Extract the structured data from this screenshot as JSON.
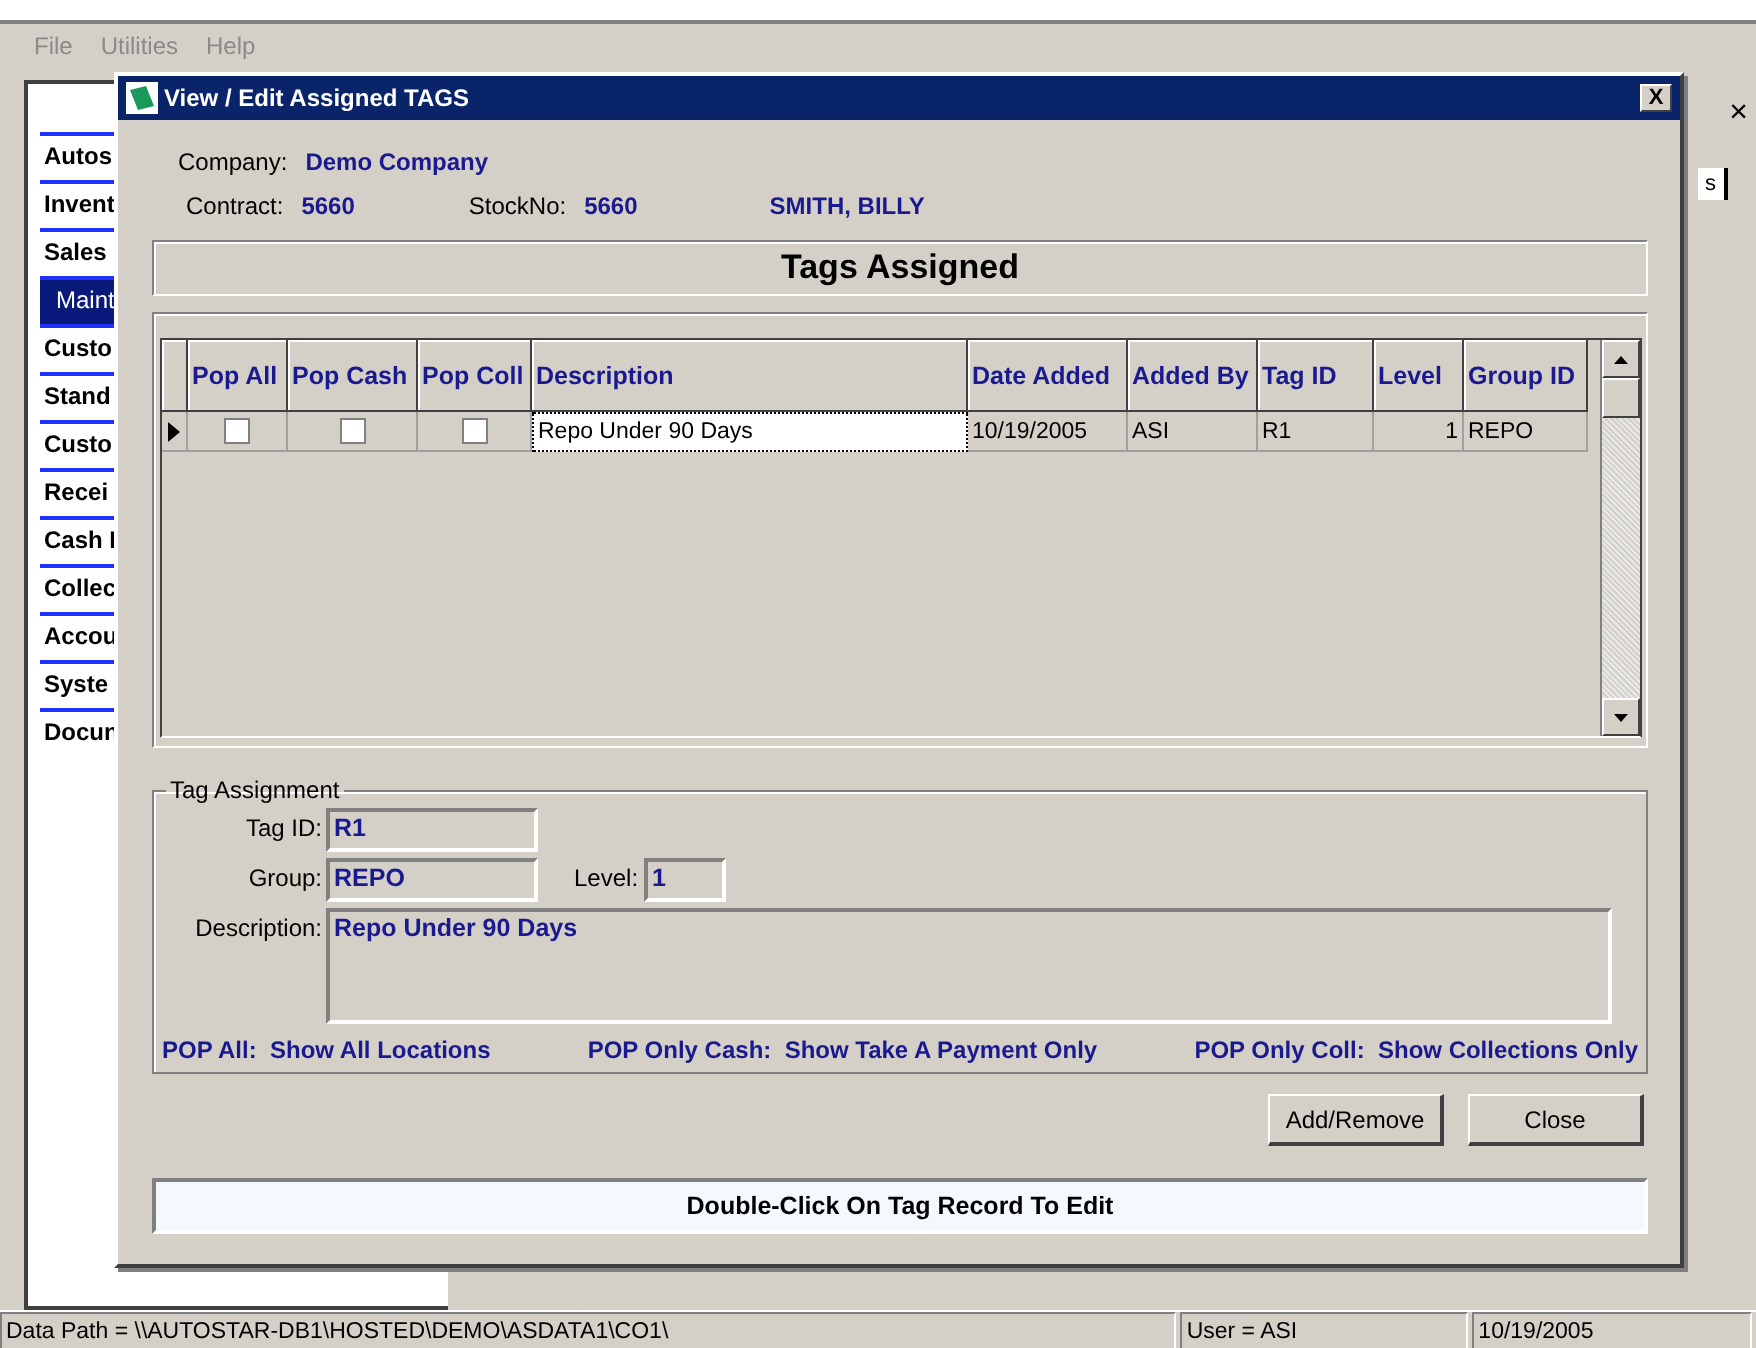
{
  "menu": [
    "File",
    "Utilities",
    "Help"
  ],
  "sidebar": {
    "items": [
      {
        "label": "Autos",
        "selected": false
      },
      {
        "label": "Invent",
        "selected": false
      },
      {
        "label": "Sales",
        "selected": false
      },
      {
        "label": "Maint",
        "selected": true
      },
      {
        "label": "Custo",
        "selected": false
      },
      {
        "label": "Stand",
        "selected": false
      },
      {
        "label": "Custo",
        "selected": false
      },
      {
        "label": "Recei",
        "selected": false
      },
      {
        "label": "Cash I",
        "selected": false
      },
      {
        "label": "Collec",
        "selected": false
      },
      {
        "label": "Accou",
        "selected": false
      },
      {
        "label": "Syste",
        "selected": false
      },
      {
        "label": "Docun",
        "selected": false
      }
    ]
  },
  "background": {
    "close": "×",
    "tab": "s"
  },
  "dialog": {
    "title": "View / Edit Assigned TAGS",
    "close": "X",
    "info": [
      {
        "label": "Company:",
        "value": "Demo Company"
      },
      {
        "label": "Contract:",
        "value": "5660"
      },
      {
        "label": "StockNo:",
        "value": "5660"
      },
      {
        "value": "SMITH, BILLY"
      }
    ],
    "header": "Tags Assigned",
    "grid": {
      "columns": [
        "Pop All",
        "Pop Cash",
        "Pop Coll",
        "Description",
        "Date Added",
        "Added By",
        "Tag ID",
        "Level",
        "Group ID"
      ],
      "rows": [
        {
          "current": true,
          "pop_all": false,
          "pop_cash": false,
          "pop_coll": false,
          "description": "Repo Under 90 Days",
          "date_added": "10/19/2005",
          "added_by": "ASI",
          "tag_id": "R1",
          "level": "1",
          "group_id": "REPO"
        }
      ]
    },
    "assignment": {
      "legend": "Tag Assignment",
      "tag_id": {
        "label": "Tag ID:",
        "value": "R1"
      },
      "group": {
        "label": "Group:",
        "value": "REPO"
      },
      "level": {
        "label": "Level:",
        "value": "1"
      },
      "description": {
        "label": "Description:",
        "value": "Repo Under 90 Days"
      },
      "notes": [
        "POP All:  Show All Locations",
        "POP Only Cash:  Show Take A Payment Only",
        "POP Only Coll:  Show Collections Only"
      ]
    },
    "buttons": [
      "Add/Remove",
      "Close"
    ],
    "hint": "Double-Click On Tag Record To Edit"
  },
  "status_bar": [
    "Data Path = \\\\AUTOSTAR-DB1\\HOSTED\\DEMO\\ASDATA1\\CO1\\",
    "User = ASI",
    "10/19/2005"
  ]
}
